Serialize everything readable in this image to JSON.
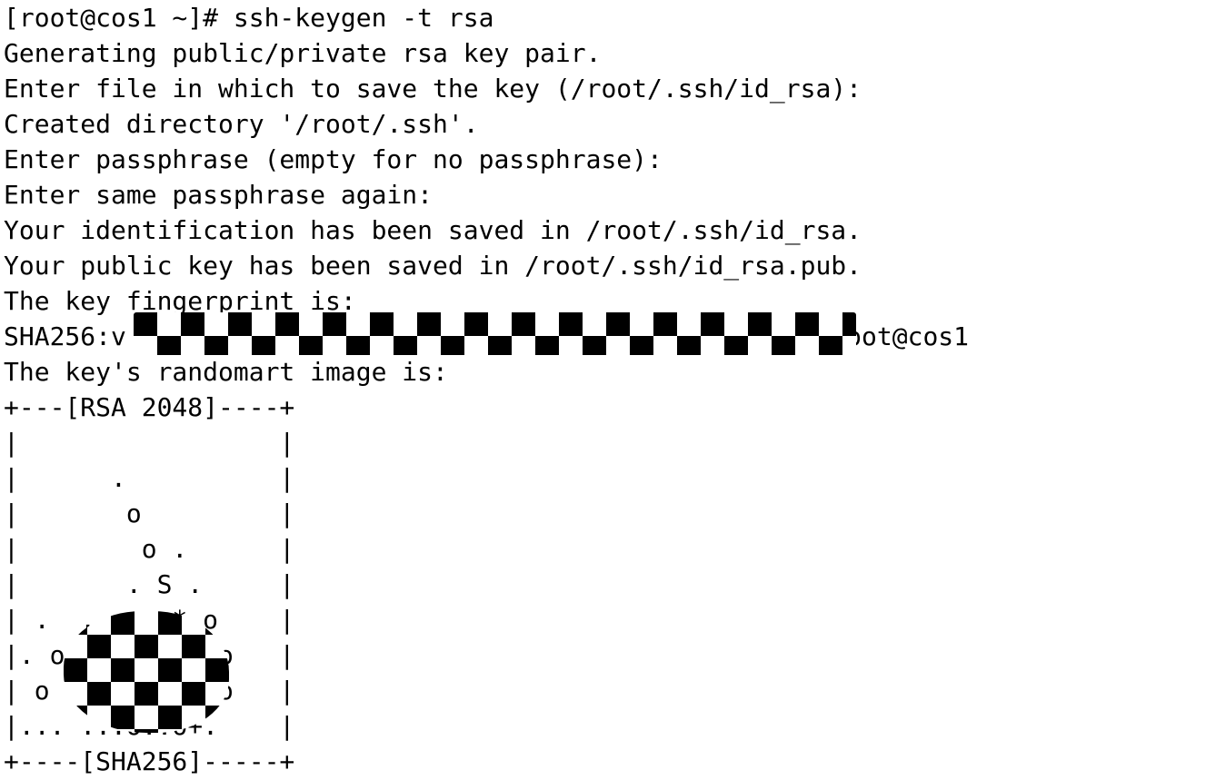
{
  "terminal": {
    "title": "ssh-keygen -t rsa",
    "background_color": "#ffffff",
    "foreground_color": "#000000",
    "prompt": "[root@cos1 ~]#",
    "command": "ssh-keygen -t rsa",
    "lines": [
      "[root@cos1 ~]# ssh-keygen -t rsa",
      "Generating public/private rsa key pair.",
      "Enter file in which to save the key (/root/.ssh/id_rsa):",
      "Created directory '/root/.ssh'.",
      "Enter passphrase (empty for no passphrase):",
      "Enter same passphrase again:",
      "Your identification has been saved in /root/.ssh/id_rsa.",
      "Your public key has been saved in /root/.ssh/id_rsa.pub.",
      "The key fingerprint is:",
      "SHA256:v                                            o root@cos1",
      "The key's randomart image is:",
      "+---[RSA 2048]----+",
      "|                 |",
      "|      .          |",
      "|       o         |",
      "|        o .      |",
      "|       . S .     |",
      "| .  . o o * o    |",
      "|. o  . . . * o   |",
      "| o   . . . . o   |",
      "|... ...o..o+.    |",
      "+----[SHA256]-----+"
    ],
    "redactions": [
      {
        "name": "fingerprint-redaction",
        "description": "checkerboard mosaic covering the SHA256 key fingerprint hash",
        "line_index": 9,
        "shape": "rectangle"
      },
      {
        "name": "randomart-redaction",
        "description": "checkerboard mosaic blob covering part of the randomart image",
        "line_index": 16,
        "shape": "blob"
      }
    ]
  }
}
